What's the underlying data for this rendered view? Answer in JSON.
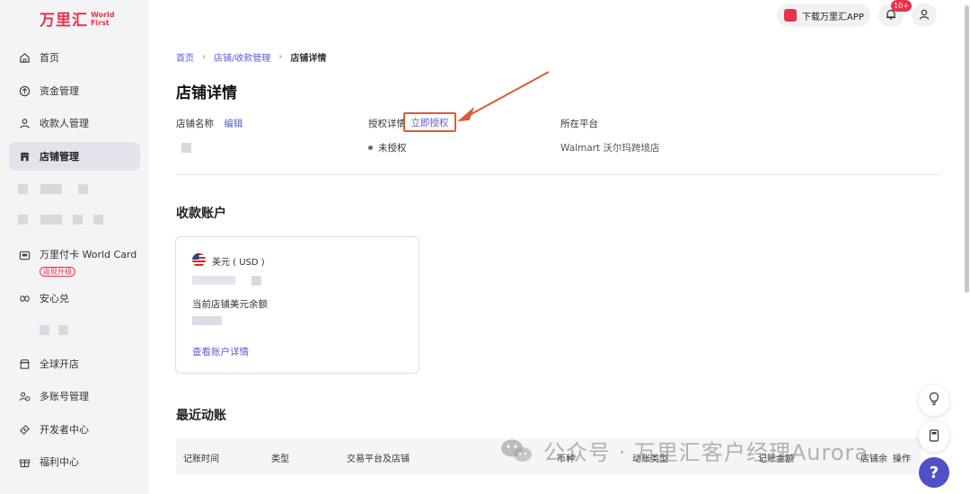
{
  "brand": {
    "name_cn": "万里汇",
    "name_en_line1": "World",
    "name_en_line2": "First",
    "color": "#e8334a"
  },
  "sidebar": {
    "items": [
      {
        "label": "首页",
        "icon": "home-icon"
      },
      {
        "label": "资金管理",
        "icon": "funds-icon"
      },
      {
        "label": "收款人管理",
        "icon": "payee-icon"
      },
      {
        "label": "店铺管理",
        "icon": "store-icon",
        "active": true
      },
      {
        "label": "万里付卡 World Card",
        "icon": "card-icon",
        "badge": "返现升级"
      },
      {
        "label": "安心兑",
        "icon": "exchange-icon"
      },
      {
        "label": "全球开店",
        "icon": "global-store-icon"
      },
      {
        "label": "多账号管理",
        "icon": "multi-account-icon"
      },
      {
        "label": "开发者中心",
        "icon": "developer-icon"
      },
      {
        "label": "福利中心",
        "icon": "gift-icon"
      }
    ]
  },
  "topbar": {
    "download_label": "下载万里汇APP",
    "notification_count": "10+"
  },
  "breadcrumb": {
    "home": "首页",
    "section": "店铺/收款管理",
    "current": "店铺详情"
  },
  "page": {
    "title": "店铺详情",
    "store_name_label": "店铺名称",
    "edit_link": "编辑",
    "auth_label": "授权详情",
    "auth_link": "立即授权",
    "auth_status": "未授权",
    "platform_label": "所在平台",
    "platform_value": "Walmart 沃尔玛跨境店"
  },
  "accounts": {
    "title": "收款账户",
    "card": {
      "currency": "美元 ( USD )",
      "balance_label": "当前店铺美元余额",
      "details_link": "查看账户详情"
    }
  },
  "recent": {
    "title": "最近动账",
    "columns": [
      "记账时间",
      "类型",
      "交易平台及店铺",
      "币种",
      "动账类型",
      "记账金额",
      "店铺余",
      "操作"
    ]
  },
  "watermark": "公众号 · 万里汇客户经理Aurora",
  "colors": {
    "accent": "#5b5bd6",
    "annotation": "#e05a38",
    "help": "#5051c5"
  }
}
